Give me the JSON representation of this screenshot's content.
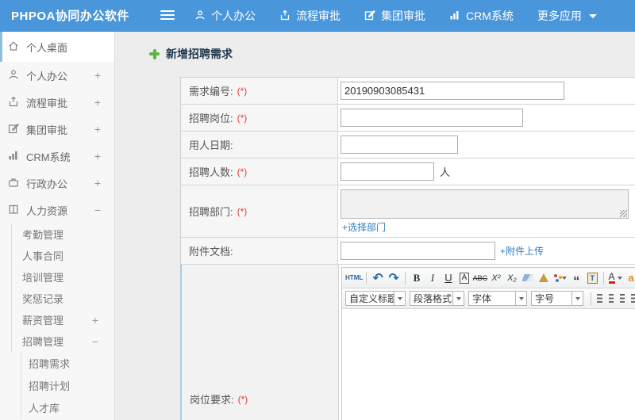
{
  "theme": {
    "navbar_blue": "#4a96db",
    "link_blue": "#2e7fc1",
    "required_red": "#e23b3b",
    "accent_green": "#5db53f",
    "sidebar_active_bar": "#8fc0dc"
  },
  "navbar": {
    "brand": "PHPOA协同办公软件",
    "menu": [
      {
        "label": "个人办公",
        "icon": "user-icon"
      },
      {
        "label": "流程审批",
        "icon": "upload-icon"
      },
      {
        "label": "集团审批",
        "icon": "edit-icon"
      },
      {
        "label": "CRM系统",
        "icon": "bar-chart-icon"
      },
      {
        "label": "更多应用",
        "icon": "caret-down-icon"
      }
    ]
  },
  "sidebar": {
    "items": [
      {
        "label": "个人桌面",
        "icon": "home-icon",
        "active": true
      },
      {
        "label": "个人办公",
        "icon": "user-icon",
        "toggle": "+"
      },
      {
        "label": "流程审批",
        "icon": "upload-icon",
        "toggle": "+"
      },
      {
        "label": "集团审批",
        "icon": "edit-icon",
        "toggle": "+"
      },
      {
        "label": "CRM系统",
        "icon": "bar-chart-icon",
        "toggle": "+"
      },
      {
        "label": "行政办公",
        "icon": "briefcase-icon",
        "toggle": "+"
      },
      {
        "label": "人力资源",
        "icon": "book-icon",
        "toggle": "−"
      },
      {
        "label": "考勤管理"
      },
      {
        "label": "人事合同"
      },
      {
        "label": "培训管理"
      },
      {
        "label": "奖惩记录"
      },
      {
        "label": "薪资管理",
        "toggle": "+"
      },
      {
        "label": "招聘管理",
        "toggle": "−"
      },
      {
        "label": "招聘需求"
      },
      {
        "label": "招聘计划"
      },
      {
        "label": "人才库"
      }
    ]
  },
  "page": {
    "title": "新增招聘需求"
  },
  "form": {
    "rows": [
      {
        "label": "需求编号:",
        "required": "(*)",
        "value": "20190903085431"
      },
      {
        "label": "招聘岗位:",
        "required": "(*)",
        "value": ""
      },
      {
        "label": "用人日期:",
        "value": ""
      },
      {
        "label": "招聘人数:",
        "required": "(*)",
        "value": "",
        "suffix": "人"
      },
      {
        "label": "招聘部门:",
        "required": "(*)",
        "link": "+选择部门"
      },
      {
        "label": "附件文档:",
        "value": "",
        "link": "+附件上传"
      },
      {
        "label": "岗位要求:",
        "required": "(*)"
      }
    ]
  },
  "editor": {
    "html_button": "HTML",
    "undo": "↶",
    "redo": "↷",
    "bold": "B",
    "italic": "I",
    "underline": "U",
    "autotypeset": "A",
    "strikethrough": "ABC",
    "superscript": "X²",
    "subscript": "X₂",
    "blockquote": "“",
    "paste_label": "T",
    "fontcolor": "A",
    "partial_icon": "a",
    "dropdowns": [
      {
        "label": "自定义标题"
      },
      {
        "label": "段落格式"
      },
      {
        "label": "字体"
      },
      {
        "label": "字号"
      }
    ]
  }
}
